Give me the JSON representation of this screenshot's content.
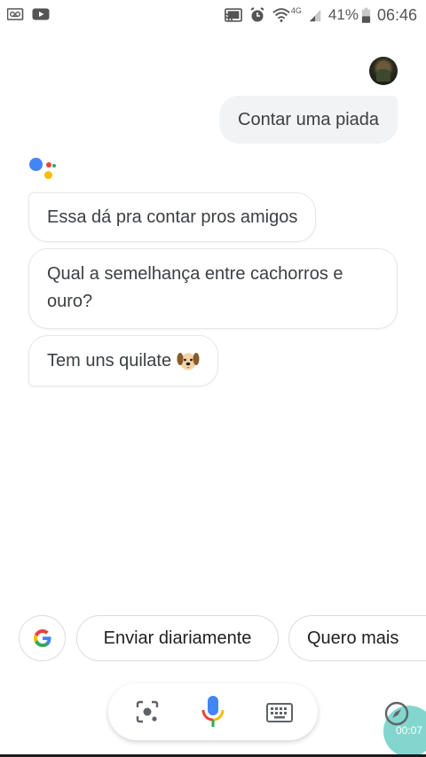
{
  "status_bar": {
    "battery": "41%",
    "time": "06:46",
    "network": "4G",
    "icons_left": [
      "voicemail-icon",
      "youtube-icon"
    ],
    "icons_right": [
      "cast-icon",
      "alarm-icon",
      "wifi-icon",
      "signal-icon",
      "battery-icon"
    ]
  },
  "conversation": {
    "user_query": "Contar uma piada",
    "assistant_messages": [
      "Essa dá pra contar pros amigos",
      "Qual a semelhança entre cachorros e ouro?",
      "Tem uns quilate"
    ],
    "emoji": "dog-face"
  },
  "suggestions": {
    "items": [
      "Enviar diariamente",
      "Quero mais"
    ]
  },
  "recorder": {
    "timer": "00:07"
  },
  "colors": {
    "google_blue": "#4285F4",
    "google_red": "#EA4335",
    "google_yellow": "#FBBC05",
    "google_green": "#34A853",
    "bubble_user": "#f1f3f4"
  }
}
